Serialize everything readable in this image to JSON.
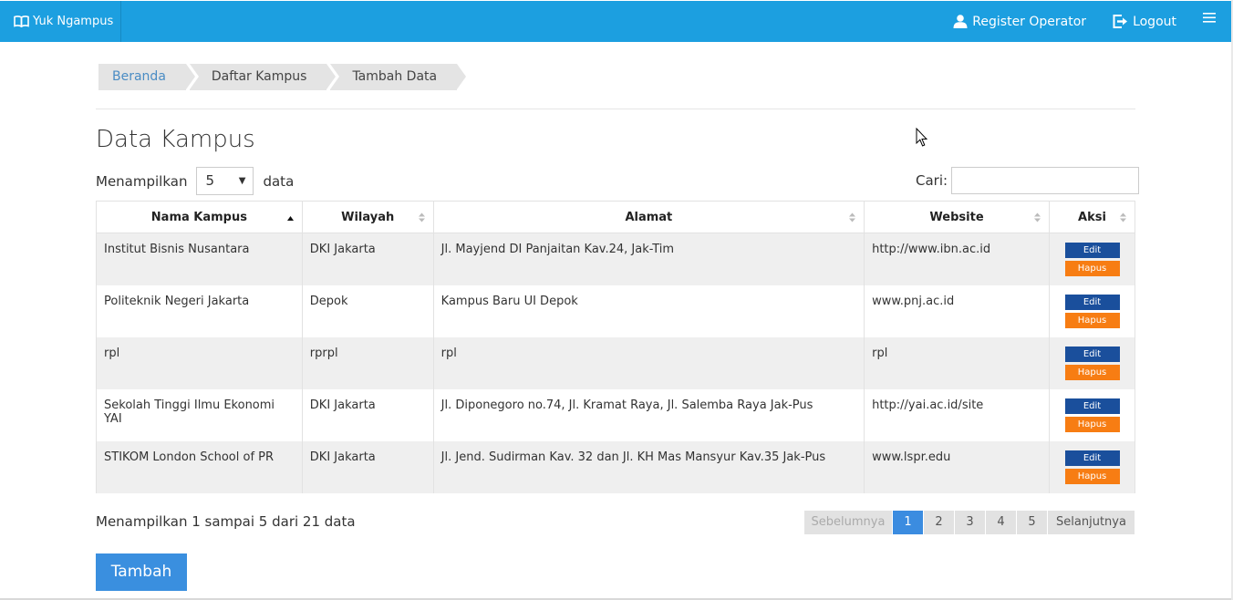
{
  "navbar": {
    "brand": "Yuk Ngampus",
    "register": "Register Operator",
    "logout": "Logout"
  },
  "breadcrumb": [
    "Beranda",
    "Daftar Kampus",
    "Tambah Data"
  ],
  "page_title": "Data Kampus",
  "length": {
    "prefix": "Menampilkan",
    "value": "5",
    "suffix": "data"
  },
  "search": {
    "label": "Cari:",
    "value": ""
  },
  "table": {
    "headers": [
      "Nama Kampus",
      "Wilayah",
      "Alamat",
      "Website",
      "Aksi"
    ],
    "rows": [
      [
        "Institut Bisnis Nusantara",
        "DKI Jakarta",
        "Jl. Mayjend DI Panjaitan Kav.24, Jak-Tim",
        "http://www.ibn.ac.id"
      ],
      [
        "Politeknik Negeri Jakarta",
        "Depok",
        "Kampus Baru UI Depok",
        "www.pnj.ac.id"
      ],
      [
        "rpl",
        "rprpl",
        "rpl",
        "rpl"
      ],
      [
        "Sekolah Tinggi Ilmu Ekonomi YAI",
        "DKI Jakarta",
        "Jl. Diponegoro no.74, Jl. Kramat Raya, Jl. Salemba Raya Jak-Pus",
        "http://yai.ac.id/site"
      ],
      [
        "STIKOM London School of PR",
        "DKI Jakarta",
        "Jl. Jend. Sudirman Kav. 32 dan Jl. KH Mas Mansyur Kav.35 Jak-Pus",
        "www.lspr.edu"
      ]
    ],
    "edit_label": "Edit",
    "delete_label": "Hapus"
  },
  "info": "Menampilkan 1 sampai 5 dari 21 data",
  "pagination": {
    "prev": "Sebelumnya",
    "pages": [
      "1",
      "2",
      "3",
      "4",
      "5"
    ],
    "active": "1",
    "next": "Selanjutnya"
  },
  "add_button": "Tambah",
  "colors": {
    "navbar": "#1c9fe0",
    "edit": "#1a4f9c",
    "hapus": "#f77d13",
    "primary": "#3a8fdf"
  },
  "icons": [
    "book-icon",
    "user-icon",
    "logout-icon",
    "hamburger-icon",
    "sort-icon",
    "mouse-cursor-icon"
  ]
}
